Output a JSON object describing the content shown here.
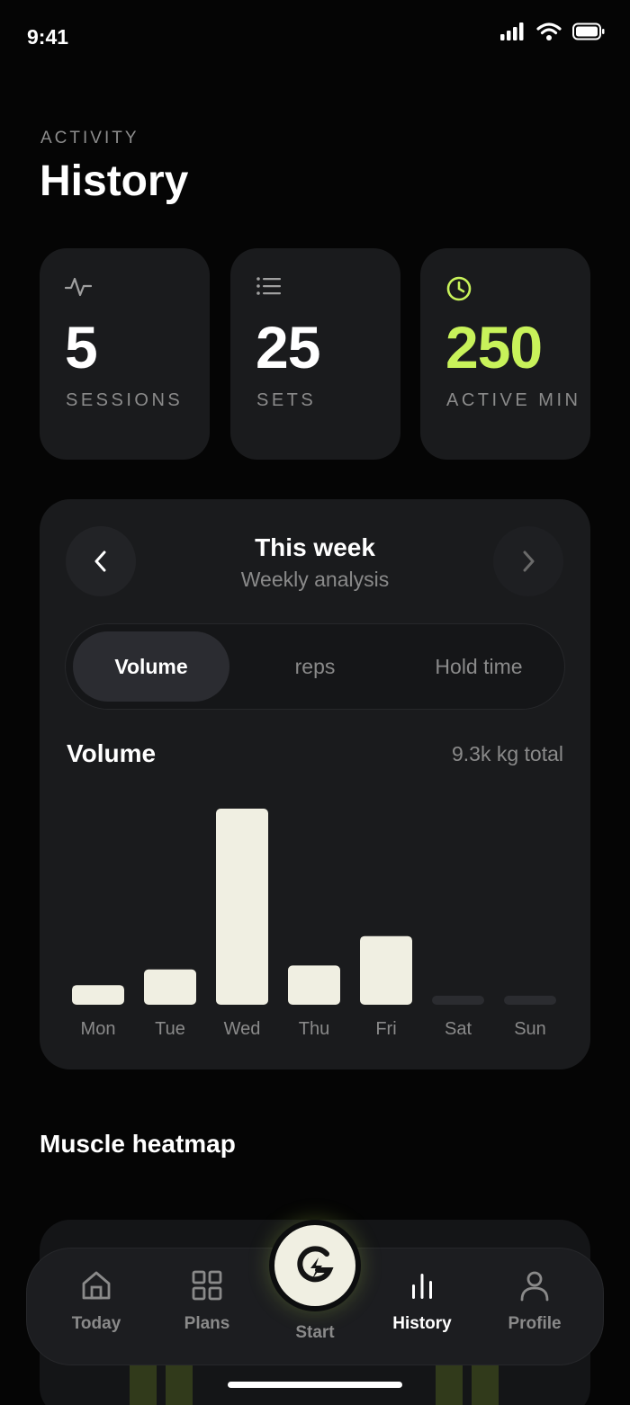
{
  "status_bar": {
    "time": "9:41"
  },
  "header": {
    "eyebrow": "ACTIVITY",
    "title": "History"
  },
  "stats": [
    {
      "icon": "activity-pulse-icon",
      "value": "5",
      "label": "SESSIONS",
      "accent": "#ffffff"
    },
    {
      "icon": "list-icon",
      "value": "25",
      "label": "SETS",
      "accent": "#ffffff"
    },
    {
      "icon": "clock-icon",
      "value": "250",
      "label": "ACTIVE MIN",
      "accent": "#c8f25a"
    }
  ],
  "week_panel": {
    "title": "This week",
    "subtitle": "Weekly analysis",
    "tabs": [
      "Volume",
      "reps",
      "Hold time"
    ],
    "active_tab": "Volume",
    "metric_title": "Volume",
    "metric_total": "9.3k kg total"
  },
  "chart_data": {
    "type": "bar",
    "categories": [
      "Mon",
      "Tue",
      "Wed",
      "Thu",
      "Fri",
      "Sat",
      "Sun"
    ],
    "values": [
      0.1,
      0.18,
      1.0,
      0.2,
      0.35,
      0,
      0
    ],
    "bar_color": "#f0efe2",
    "empty_color": "#2b2c30"
  },
  "heatmap": {
    "title": "Muscle heatmap"
  },
  "tab_bar": {
    "items": [
      {
        "label": "Today",
        "icon": "home-icon"
      },
      {
        "label": "Plans",
        "icon": "grid-icon"
      },
      {
        "label": "Start",
        "icon": "lightning-logo-icon"
      },
      {
        "label": "History",
        "icon": "bar-chart-icon"
      },
      {
        "label": "Profile",
        "icon": "user-icon"
      }
    ],
    "active": "History"
  },
  "colors": {
    "accent": "#c8f25a",
    "background": "#050505",
    "card": "#1a1b1d"
  }
}
